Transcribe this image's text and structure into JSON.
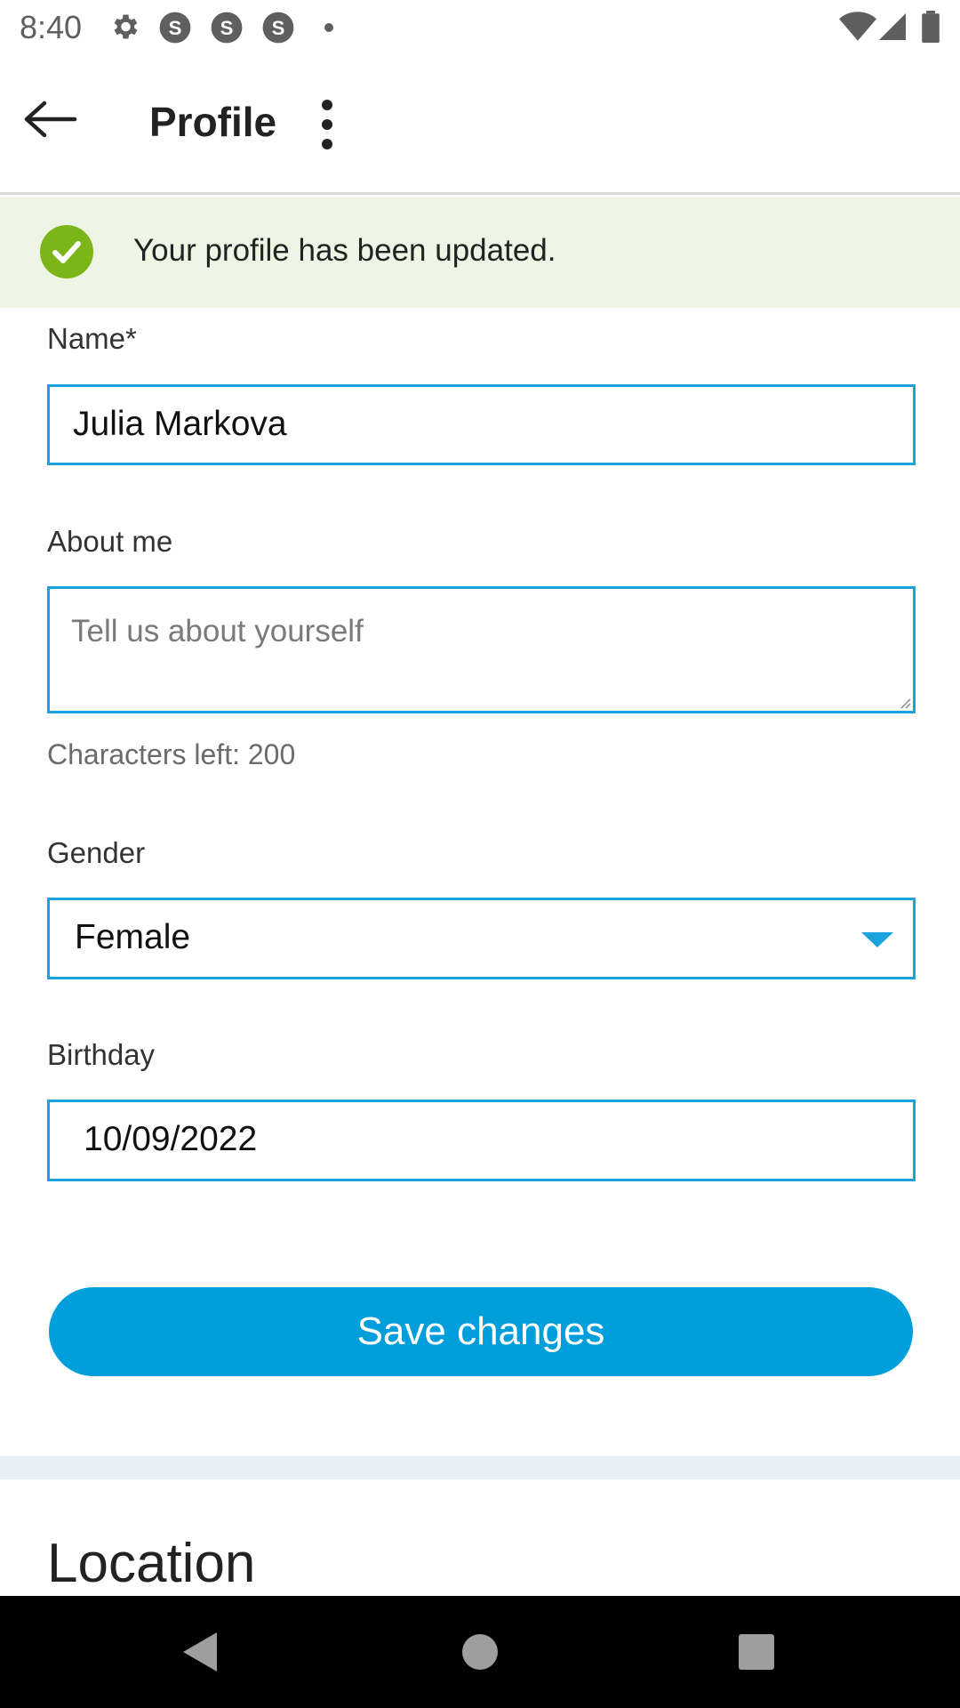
{
  "status_bar": {
    "time": "8:40",
    "icons": [
      "gear-icon",
      "skype-notification-icon",
      "skype-notification-icon",
      "skype-notification-icon",
      "dot-icon",
      "wifi-icon",
      "signal-icon",
      "battery-icon"
    ]
  },
  "app_bar": {
    "title": "Profile",
    "back_icon": "arrow-left-icon",
    "menu_icon": "more-vert-icon"
  },
  "banner": {
    "message": "Your profile has been updated.",
    "icon": "check-circle-icon",
    "color": "#7cb518"
  },
  "form": {
    "name": {
      "label": "Name*",
      "value": "Julia Markova"
    },
    "about": {
      "label": "About me",
      "placeholder": "Tell us about yourself",
      "value": "",
      "helper": "Characters left: 200"
    },
    "gender": {
      "label": "Gender",
      "value": "Female"
    },
    "birthday": {
      "label": "Birthday",
      "value": "10/09/2022"
    },
    "save_label": "Save changes"
  },
  "location": {
    "title": "Location"
  },
  "colors": {
    "accent": "#009fdb",
    "field_border": "#1aa3dc",
    "banner_bg": "#eef5e4"
  }
}
